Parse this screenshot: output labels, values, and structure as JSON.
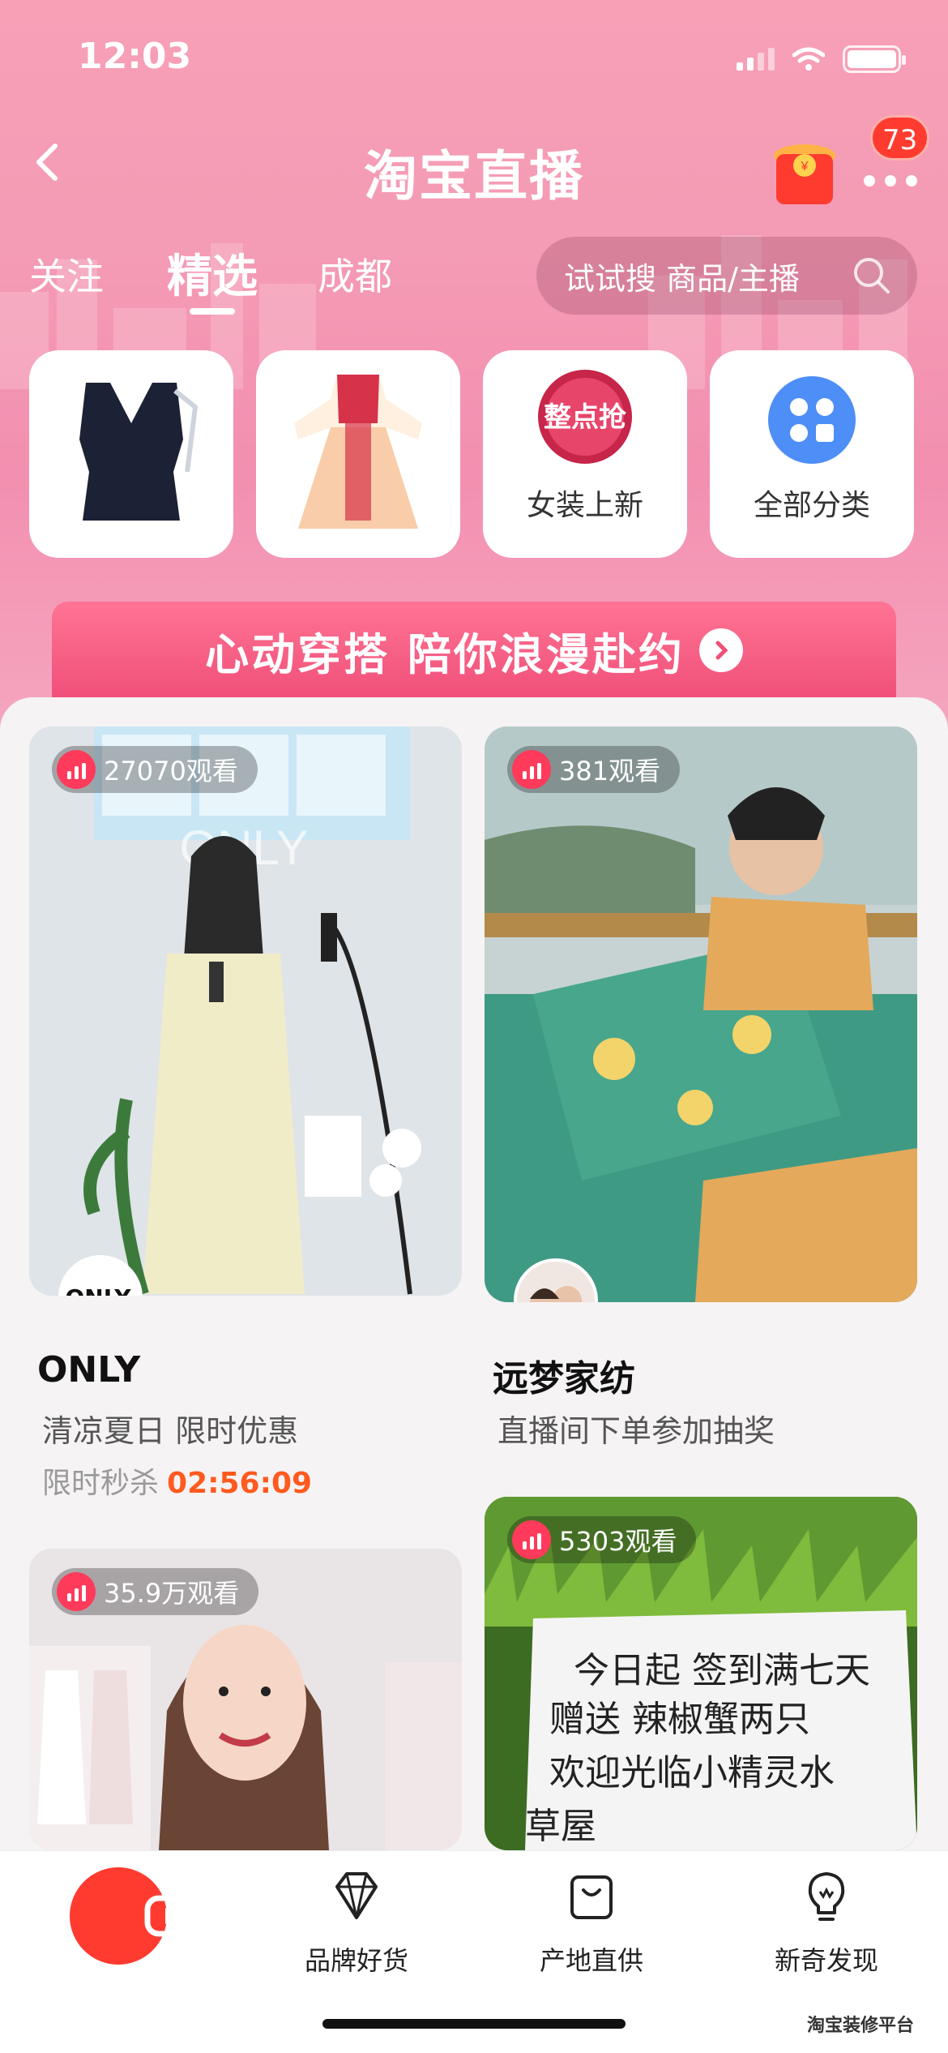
{
  "status_bar": {
    "time": "12:03"
  },
  "nav": {
    "title": "淘宝直播",
    "badge_count": "73"
  },
  "tabs": [
    {
      "label": "关注"
    },
    {
      "label": "精选",
      "active": true
    },
    {
      "label": "成都"
    }
  ],
  "search": {
    "placeholder": "试试搜 商品/主播"
  },
  "categories": [
    {
      "label": "",
      "image": "black-top-product"
    },
    {
      "label": "",
      "image": "hanfu-dress-product"
    },
    {
      "label": "女装上新",
      "image": "new-arrivals-badge"
    },
    {
      "label": "全部分类",
      "image": "all-categories-icon"
    }
  ],
  "banner": {
    "text": "心动穿搭 陪你浪漫赴约"
  },
  "feed": [
    {
      "viewers": "27070观看",
      "shop": "ONLY",
      "desc": "清凉夏日 限时优惠",
      "flash_label": "限时秒杀",
      "flash_time": "02:56:09",
      "avatar_text": "ONLY."
    },
    {
      "viewers": "381观看",
      "shop": "远梦家纺",
      "desc": "直播间下单参加抽奖"
    },
    {
      "viewers": "35.9万观看"
    },
    {
      "viewers": "5303观看",
      "note_lines": [
        "今日起 签到满七天",
        "赠送 辣椒蟹两只",
        "欢迎光临小精灵水",
        "草屋"
      ]
    }
  ],
  "bottom_nav": [
    {
      "label": "",
      "icon": "live-play-icon"
    },
    {
      "label": "品牌好货",
      "icon": "diamond-icon"
    },
    {
      "label": "产地直供",
      "icon": "bag-icon"
    },
    {
      "label": "新奇发现",
      "icon": "bulb-icon"
    }
  ],
  "watermark": "淘宝装修平台",
  "colors": {
    "accent": "#ff3b30",
    "pink": "#f49bb5",
    "countdown": "#ff5a1f"
  }
}
